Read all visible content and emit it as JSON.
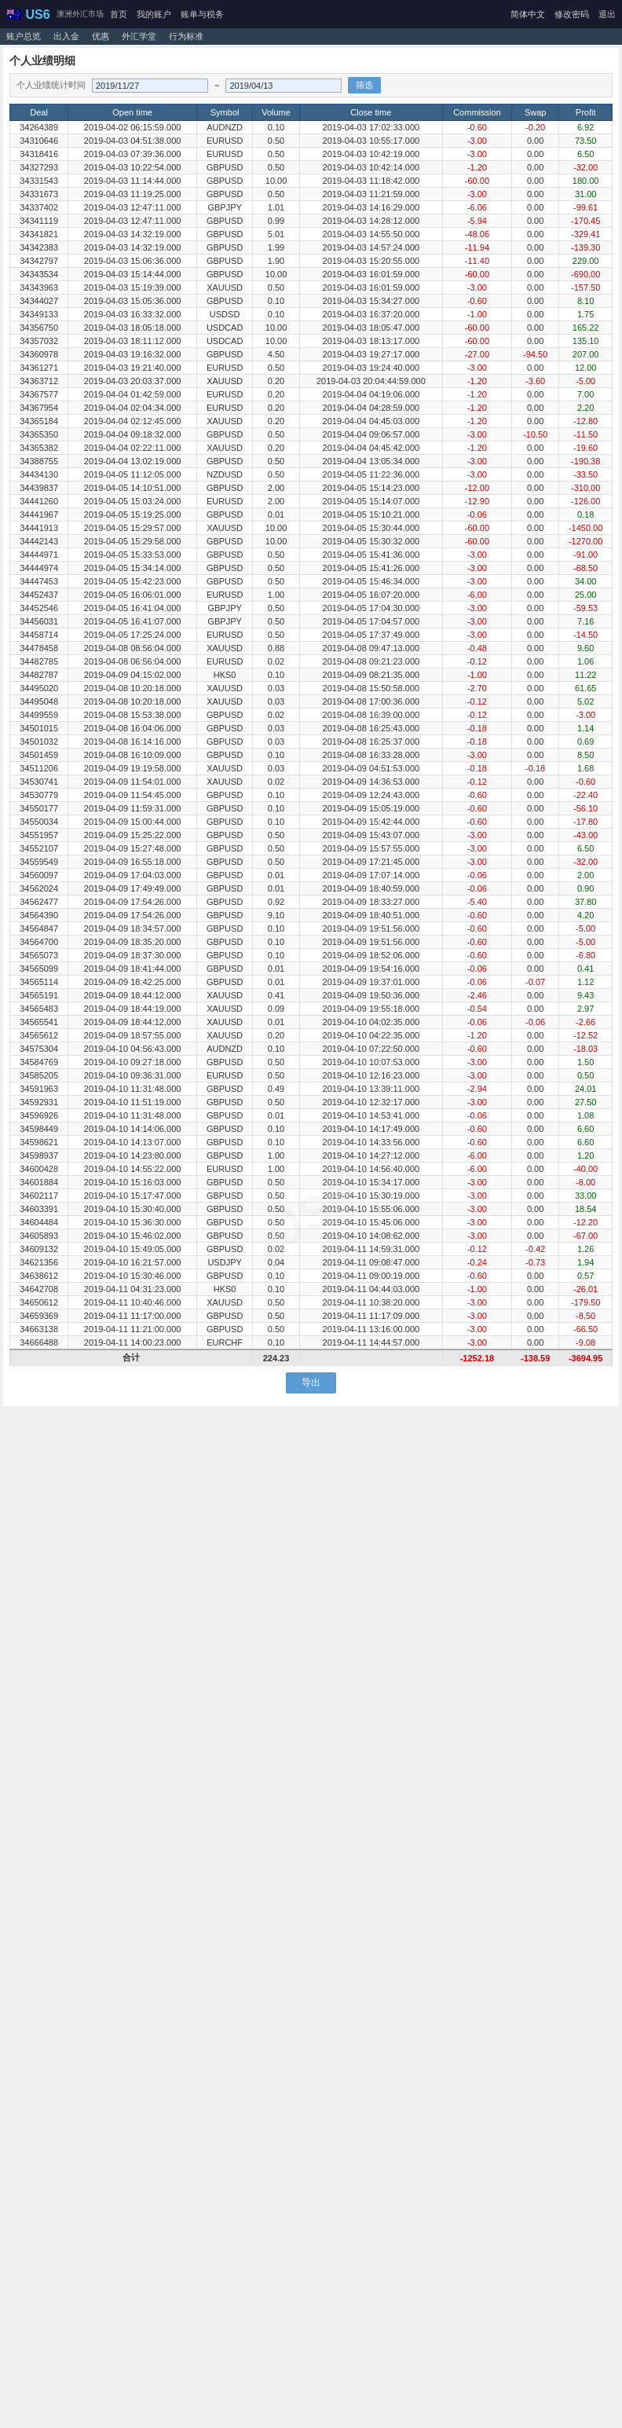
{
  "header": {
    "logo": "🇦🇺 US6",
    "subtitle": "澳洲外汇市场",
    "nav_items": [
      "首页",
      "我的账户",
      "账单与税务"
    ],
    "sub_nav": [
      "账户总览",
      "出入金",
      "优惠",
      "外汇学堂",
      "行为标准"
    ],
    "lang": "简体中文",
    "user_actions": [
      "修改密码",
      "退出"
    ]
  },
  "page": {
    "title": "个人业绩明细",
    "filter_label": "个人业绩统计时间",
    "date_from": "2019/11/27",
    "date_to": "2019/04/13",
    "filter_btn": "筛选",
    "export_btn": "导出"
  },
  "table": {
    "columns": [
      "Deal",
      "Open time",
      "Symbol",
      "Volume",
      "Close time",
      "Commission",
      "Swap",
      "Profit"
    ],
    "rows": [
      [
        "34264389",
        "2019-04-02 06:15:59.000",
        "AUDNZD",
        "0.10",
        "2019-04-03 17:02:33.000",
        "-0.60",
        "-0.20",
        "6.92"
      ],
      [
        "34310646",
        "2019-04-03 04:51:38.000",
        "EURUSD",
        "0.50",
        "2019-04-03 10:55:17.000",
        "-3.00",
        "0.00",
        "73.50"
      ],
      [
        "34318416",
        "2019-04-03 07:39:36.000",
        "EURUSD",
        "0.50",
        "2019-04-03 10:42:19.000",
        "-3.00",
        "0.00",
        "6.50"
      ],
      [
        "34327293",
        "2019-04-03 10:22:54.000",
        "GBPUSD",
        "0.50",
        "2019-04-03 10:42:14.000",
        "-1.20",
        "0.00",
        "-32.00"
      ],
      [
        "34331543",
        "2019-04-03 11:14:44.000",
        "GBPUSD",
        "10.00",
        "2019-04-03 11:18:42.000",
        "-60.00",
        "0.00",
        "180.00"
      ],
      [
        "34331673",
        "2019-04-03 11:19:25.000",
        "GBPUSD",
        "0.50",
        "2019-04-03 11:21:59.000",
        "-3.00",
        "0.00",
        "31.00"
      ],
      [
        "34337402",
        "2019-04-03 12:47:11.000",
        "GBPJPY",
        "1.01",
        "2019-04-03 14:16:29.000",
        "-6.06",
        "0.00",
        "-99.61"
      ],
      [
        "34341119",
        "2019-04-03 12:47:11.000",
        "GBPUSD",
        "0.99",
        "2019-04-03 14:28:12.000",
        "-5.94",
        "0.00",
        "-170.45"
      ],
      [
        "34341821",
        "2019-04-03 14:32:19.000",
        "GBPUSD",
        "5.01",
        "2019-04-03 14:55:50.000",
        "-48.06",
        "0.00",
        "-329.41"
      ],
      [
        "34342383",
        "2019-04-03 14:32:19.000",
        "GBPUSD",
        "1.99",
        "2019-04-03 14:57:24.000",
        "-11.94",
        "0.00",
        "-139.30"
      ],
      [
        "34342797",
        "2019-04-03 15:06:36.000",
        "GBPUSD",
        "1.90",
        "2019-04-03 15:20:55.000",
        "-11.40",
        "0.00",
        "229.00"
      ],
      [
        "34343534",
        "2019-04-03 15:14:44.000",
        "GBPUSD",
        "10.00",
        "2019-04-03 16:01:59.000",
        "-60.00",
        "0.00",
        "-690.00"
      ],
      [
        "34343963",
        "2019-04-03 15:19:39.000",
        "XAUUSD",
        "0.50",
        "2019-04-03 16:01:59.000",
        "-3.00",
        "0.00",
        "-157.50"
      ],
      [
        "34344027",
        "2019-04-03 15:05:36.000",
        "GBPUSD",
        "0.10",
        "2019-04-03 15:34:27.000",
        "-0.60",
        "0.00",
        "8.10"
      ],
      [
        "34349133",
        "2019-04-03 16:33:32.000",
        "USDSD",
        "0.10",
        "2019-04-03 16:37:20.000",
        "-1.00",
        "0.00",
        "1.75"
      ],
      [
        "34356750",
        "2019-04-03 18:05:18.000",
        "USDCAD",
        "10.00",
        "2019-04-03 18:05:47.000",
        "-60.00",
        "0.00",
        "165.22"
      ],
      [
        "34357032",
        "2019-04-03 18:11:12.000",
        "USDCAD",
        "10.00",
        "2019-04-03 18:13:17.000",
        "-60.00",
        "0.00",
        "135.10"
      ],
      [
        "34360978",
        "2019-04-03 19:16:32.000",
        "GBPUSD",
        "4.50",
        "2019-04-03 19:27:17.000",
        "-27.00",
        "-94.50",
        "207.00"
      ],
      [
        "34361271",
        "2019-04-03 19:21:40.000",
        "EURUSD",
        "0.50",
        "2019-04-03 19:24:40.000",
        "-3.00",
        "0.00",
        "12.00"
      ],
      [
        "34363712",
        "2019-04-03 20:03:37.000",
        "XAUUSD",
        "0.20",
        "2019-04-03 20:04:44:59.000",
        "-1.20",
        "-3.60",
        "-5.00"
      ],
      [
        "34367577",
        "2019-04-04 01:42:59.000",
        "EURUSD",
        "0.20",
        "2019-04-04 04:19:06.000",
        "-1.20",
        "0.00",
        "7.00"
      ],
      [
        "34367954",
        "2019-04-04 02:04:34.000",
        "EURUSD",
        "0.20",
        "2019-04-04 04:28:59.000",
        "-1.20",
        "0.00",
        "2.20"
      ],
      [
        "34365184",
        "2019-04-04 02:12:45.000",
        "XAUUSD",
        "0.20",
        "2019-04-04 04:45:03.000",
        "-1.20",
        "0.00",
        "-12.80"
      ],
      [
        "34365350",
        "2019-04-04 09:18:32.000",
        "GBPUSD",
        "0.50",
        "2019-04-04 09:06:57.000",
        "-3.00",
        "-10.50",
        "-11.50"
      ],
      [
        "34365382",
        "2019-04-04 02:22:11.000",
        "XAUUSD",
        "0.20",
        "2019-04-04 04:45:42.000",
        "-1.20",
        "0.00",
        "-19.60"
      ],
      [
        "34388755",
        "2019-04-04 13:02:19.000",
        "GBPUSD",
        "0.50",
        "2019-04-04 13:05:34.000",
        "-3.00",
        "0.00",
        "-190.38"
      ],
      [
        "34434130",
        "2019-04-05 11:12:05.000",
        "NZDUSD",
        "0.50",
        "2019-04-05 11:22:36.000",
        "-3.00",
        "0.00",
        "-33.50"
      ],
      [
        "34439837",
        "2019-04-05 14:10:51.000",
        "GBPUSD",
        "2.00",
        "2019-04-05 15:14:23.000",
        "-12.00",
        "0.00",
        "-310.00"
      ],
      [
        "34441260",
        "2019-04-05 15:03:24.000",
        "EURUSD",
        "2.00",
        "2019-04-05 15:14:07.000",
        "-12.90",
        "0.00",
        "-126.00"
      ],
      [
        "34441967",
        "2019-04-05 15:19:25.000",
        "GBPUSD",
        "0.01",
        "2019-04-05 15:10:21.000",
        "-0.06",
        "0.00",
        "0.18"
      ],
      [
        "34441913",
        "2019-04-05 15:29:57.000",
        "XAUUSD",
        "10.00",
        "2019-04-05 15:30:44.000",
        "-60.00",
        "0.00",
        "-1450.00"
      ],
      [
        "34442143",
        "2019-04-05 15:29:58.000",
        "GBPUSD",
        "10.00",
        "2019-04-05 15:30:32.000",
        "-60.00",
        "0.00",
        "-1270.00"
      ],
      [
        "34444971",
        "2019-04-05 15:33:53.000",
        "GBPUSD",
        "0.50",
        "2019-04-05 15:41:36.000",
        "-3.00",
        "0.00",
        "-91.00"
      ],
      [
        "34444974",
        "2019-04-05 15:34:14.000",
        "GBPUSD",
        "0.50",
        "2019-04-05 15:41:26.000",
        "-3.00",
        "0.00",
        "-68.50"
      ],
      [
        "34447453",
        "2019-04-05 15:42:23.000",
        "GBPUSD",
        "0.50",
        "2019-04-05 15:46:34.000",
        "-3.00",
        "0.00",
        "34.00"
      ],
      [
        "34452437",
        "2019-04-05 16:06:01.000",
        "EURUSD",
        "1.00",
        "2019-04-05 16:07:20.000",
        "-6.00",
        "0.00",
        "25.00"
      ],
      [
        "34452546",
        "2019-04-05 16:41:04.000",
        "GBPJPY",
        "0.50",
        "2019-04-05 17:04:30.000",
        "-3.00",
        "0.00",
        "-59.53"
      ],
      [
        "34456031",
        "2019-04-05 16:41:07.000",
        "GBPJPY",
        "0.50",
        "2019-04-05 17:04:57.000",
        "-3.00",
        "0.00",
        "7.16"
      ],
      [
        "34458714",
        "2019-04-05 17:25:24.000",
        "EURUSD",
        "0.50",
        "2019-04-05 17:37:49.000",
        "-3.00",
        "0.00",
        "-14.50"
      ],
      [
        "34478458",
        "2019-04-08 08:56:04.000",
        "XAUUSD",
        "0.88",
        "2019-04-08 09:47:13.000",
        "-0.48",
        "0.00",
        "9.60"
      ],
      [
        "34482785",
        "2019-04-08 06:56:04.000",
        "EURUSD",
        "0.02",
        "2019-04-08 09:21:23.000",
        "-0.12",
        "0.00",
        "1.06"
      ],
      [
        "34482787",
        "2019-04-09 04:15:02.000",
        "HKS0",
        "0.10",
        "2019-04-09 08:21:35.000",
        "-1.00",
        "0.00",
        "11.22"
      ],
      [
        "34495020",
        "2019-04-08 10:20:18.000",
        "XAUUSD",
        "0.03",
        "2019-04-08 15:50:58.000",
        "-2.70",
        "0.00",
        "61.65"
      ],
      [
        "34495048",
        "2019-04-08 10:20:18.000",
        "XAUUSD",
        "0.03",
        "2019-04-08 17:00:36.000",
        "-0.12",
        "0.00",
        "5.02"
      ],
      [
        "34499559",
        "2019-04-08 15:53:38.000",
        "GBPUSD",
        "0.02",
        "2019-04-08 16:39:00.000",
        "-0.12",
        "0.00",
        "-3.00"
      ],
      [
        "34501015",
        "2019-04-08 16:04:06.000",
        "GBPUSD",
        "0.03",
        "2019-04-08 16:25:43.000",
        "-0.18",
        "0.00",
        "1.14"
      ],
      [
        "34501032",
        "2019-04-08 16:14:16.000",
        "GBPUSD",
        "0.03",
        "2019-04-08 16:25:37.000",
        "-0.18",
        "0.00",
        "0.69"
      ],
      [
        "34501459",
        "2019-04-08 16:10:09.000",
        "GBPUSD",
        "0.10",
        "2019-04-08 16:33:28.000",
        "-3.00",
        "0.00",
        "8.50"
      ],
      [
        "34511206",
        "2019-04-09 19:19:58.000",
        "XAUUSD",
        "0.03",
        "2019-04-09 04:51:53.000",
        "-0.18",
        "-0.18",
        "1.68"
      ],
      [
        "34530741",
        "2019-04-09 11:54:01.000",
        "XAUUSD",
        "0.02",
        "2019-04-09 14:36:53.000",
        "-0.12",
        "0.00",
        "-0.60"
      ],
      [
        "34530779",
        "2019-04-09 11:54:45.000",
        "GBPUSD",
        "0.10",
        "2019-04-09 12:24:43.000",
        "-0.60",
        "0.00",
        "-22.40"
      ],
      [
        "34550177",
        "2019-04-09 11:59:31.000",
        "GBPUSD",
        "0.10",
        "2019-04-09 15:05:19.000",
        "-0.60",
        "0.00",
        "-56.10"
      ],
      [
        "34550034",
        "2019-04-09 15:00:44.000",
        "GBPUSD",
        "0.10",
        "2019-04-09 15:42:44.000",
        "-0.60",
        "0.00",
        "-17.80"
      ],
      [
        "34551957",
        "2019-04-09 15:25:22.000",
        "GBPUSD",
        "0.50",
        "2019-04-09 15:43:07.000",
        "-3.00",
        "0.00",
        "-43.00"
      ],
      [
        "34552107",
        "2019-04-09 15:27:48.000",
        "GBPUSD",
        "0.50",
        "2019-04-09 15:57:55.000",
        "-3.00",
        "0.00",
        "6.50"
      ],
      [
        "34559549",
        "2019-04-09 16:55:18.000",
        "GBPUSD",
        "0.50",
        "2019-04-09 17:21:45.000",
        "-3.00",
        "0.00",
        "-32.00"
      ],
      [
        "34560097",
        "2019-04-09 17:04:03.000",
        "GBPUSD",
        "0.01",
        "2019-04-09 17:07:14.000",
        "-0.06",
        "0.00",
        "2.00"
      ],
      [
        "34562024",
        "2019-04-09 17:49:49.000",
        "GBPUSD",
        "0.01",
        "2019-04-09 18:40:59.000",
        "-0.06",
        "0.00",
        "0.90"
      ],
      [
        "34562477",
        "2019-04-09 17:54:26.000",
        "GBPUSD",
        "0.92",
        "2019-04-09 18:33:27.000",
        "-5.40",
        "0.00",
        "37.80"
      ],
      [
        "34564390",
        "2019-04-09 17:54:26.000",
        "GBPUSD",
        "9.10",
        "2019-04-09 18:40:51.000",
        "-0.60",
        "0.00",
        "4.20"
      ],
      [
        "34564847",
        "2019-04-09 18:34:57.000",
        "GBPUSD",
        "0.10",
        "2019-04-09 19:51:56.000",
        "-0.60",
        "0.00",
        "-5.00"
      ],
      [
        "34564700",
        "2019-04-09 18:35:20.000",
        "GBPUSD",
        "0.10",
        "2019-04-09 19:51:56.000",
        "-0.60",
        "0.00",
        "-5.00"
      ],
      [
        "34565073",
        "2019-04-09 18:37:30.000",
        "GBPUSD",
        "0.10",
        "2019-04-09 18:52:06.000",
        "-0.60",
        "0.00",
        "-6.80"
      ],
      [
        "34565099",
        "2019-04-09 18:41:44.000",
        "GBPUSD",
        "0.01",
        "2019-04-09 19:54:16.000",
        "-0.06",
        "0.00",
        "0.41"
      ],
      [
        "34565114",
        "2019-04-09 18:42:25.000",
        "GBPUSD",
        "0.01",
        "2019-04-09 19:37:01.000",
        "-0.06",
        "-0.07",
        "1.12"
      ],
      [
        "34565191",
        "2019-04-09 18:44:12.000",
        "XAUUSD",
        "0.41",
        "2019-04-09 19:50:36.000",
        "-2.46",
        "0.00",
        "9.43"
      ],
      [
        "34565483",
        "2019-04-09 18:44:19.000",
        "XAUUSD",
        "0.09",
        "2019-04-09 19:55:18.000",
        "-0.54",
        "0.00",
        "2.97"
      ],
      [
        "34565541",
        "2019-04-09 18:44:12.000",
        "XAUUSD",
        "0.01",
        "2019-04-10 04:02:35.000",
        "-0.06",
        "-0.06",
        "-2.66"
      ],
      [
        "34565612",
        "2019-04-09 18:57:55.000",
        "XAUUSD",
        "0.20",
        "2019-04-10 04:22:35.000",
        "-1.20",
        "0.00",
        "-12.52"
      ],
      [
        "34575304",
        "2019-04-10 04:56:43.000",
        "AUDNZD",
        "0.10",
        "2019-04-10 07:22:50.000",
        "-0.60",
        "0.00",
        "-18.03"
      ],
      [
        "34584769",
        "2019-04-10 09:27:18.000",
        "GBPUSD",
        "0.50",
        "2019-04-10 10:07:53.000",
        "-3.00",
        "0.00",
        "1.50"
      ],
      [
        "34585205",
        "2019-04-10 09:36:31.000",
        "EURUSD",
        "0.50",
        "2019-04-10 12:16:23.000",
        "-3.00",
        "0.00",
        "0.50"
      ],
      [
        "34591963",
        "2019-04-10 11:31:48.000",
        "GBPUSD",
        "0.49",
        "2019-04-10 13:39:11.000",
        "-2.94",
        "0.00",
        "24.01"
      ],
      [
        "34592931",
        "2019-04-10 11:51:19.000",
        "GBPUSD",
        "0.50",
        "2019-04-10 12:32:17.000",
        "-3.00",
        "0.00",
        "27.50"
      ],
      [
        "34596926",
        "2019-04-10 11:31:48.000",
        "GBPUSD",
        "0.01",
        "2019-04-10 14:53:41.000",
        "-0.06",
        "0.00",
        "1.08"
      ],
      [
        "34598449",
        "2019-04-10 14:14:06.000",
        "GBPUSD",
        "0.10",
        "2019-04-10 14:17:49.000",
        "-0.60",
        "0.00",
        "6.60"
      ],
      [
        "34598621",
        "2019-04-10 14:13:07.000",
        "GBPUSD",
        "0.10",
        "2019-04-10 14:33:56.000",
        "-0.60",
        "0.00",
        "6.60"
      ],
      [
        "34598937",
        "2019-04-10 14:23:80.000",
        "GBPUSD",
        "1.00",
        "2019-04-10 14:27:12.000",
        "-6.00",
        "0.00",
        "1.20"
      ],
      [
        "34600428",
        "2019-04-10 14:55:22.000",
        "EURUSD",
        "1.00",
        "2019-04-10 14:56:40.000",
        "-6.00",
        "0.00",
        "-40.00"
      ],
      [
        "34601884",
        "2019-04-10 15:16:03.000",
        "GBPUSD",
        "0.50",
        "2019-04-10 15:34:17.000",
        "-3.00",
        "0.00",
        "-8.00"
      ],
      [
        "34602117",
        "2019-04-10 15:17:47.000",
        "GBPUSD",
        "0.50",
        "2019-04-10 15:30:19.000",
        "-3.00",
        "0.00",
        "33.00"
      ],
      [
        "34603391",
        "2019-04-10 15:30:40.000",
        "GBPUSD",
        "0.50",
        "2019-04-10 15:55:06.000",
        "-3.00",
        "0.00",
        "18.54"
      ],
      [
        "34604484",
        "2019-04-10 15:36:30.000",
        "GBPUSD",
        "0.50",
        "2019-04-10 15:45:06.000",
        "-3.00",
        "0.00",
        "-12.20"
      ],
      [
        "34605893",
        "2019-04-10 15:46:02.000",
        "GBPUSD",
        "0.50",
        "2019-04-10 14:08:62.000",
        "-3.00",
        "0.00",
        "-67.00"
      ],
      [
        "34609132",
        "2019-04-10 15:49:05.000",
        "GBPUSD",
        "0.02",
        "2019-04-11 14:59:31.000",
        "-0.12",
        "-0.42",
        "1.26"
      ],
      [
        "34621356",
        "2019-04-10 16:21:57.000",
        "USDJPY",
        "0.04",
        "2019-04-11 09:08:47.000",
        "-0.24",
        "-0.73",
        "1.94"
      ],
      [
        "34638612",
        "2019-04-10 15:30:46.000",
        "GBPUSD",
        "0.10",
        "2019-04-11 09:00:19.000",
        "-0.60",
        "0.00",
        "0.57"
      ],
      [
        "34642708",
        "2019-04-11 04:31:23.000",
        "HKS0",
        "0.10",
        "2019-04-11 04:44:03.000",
        "-1.00",
        "0.00",
        "-26.01"
      ],
      [
        "34650612",
        "2019-04-11 10:40:46.000",
        "XAUUSD",
        "0.50",
        "2019-04-11 10:38:20.000",
        "-3.00",
        "0.00",
        "-179.50"
      ],
      [
        "34659369",
        "2019-04-11 11:17:00.000",
        "GBPUSD",
        "0.50",
        "2019-04-11 11:17:09.000",
        "-3.00",
        "0.00",
        "-8.50"
      ],
      [
        "34663138",
        "2019-04-11 11:21:00.000",
        "GBPUSD",
        "0.50",
        "2019-04-11 13:16:00.000",
        "-3.00",
        "0.00",
        "-66.50"
      ],
      [
        "34666488",
        "2019-04-11 14:00:23.000",
        "EURCHF",
        "0.10",
        "2019-04-11 14:44:57.000",
        "-3.00",
        "0.00",
        "-9.08"
      ]
    ],
    "footer": {
      "deal": "合计",
      "volume": "224.23",
      "commission": "-1252.18",
      "swap": "-138.59",
      "profit": "-3694.95"
    }
  }
}
